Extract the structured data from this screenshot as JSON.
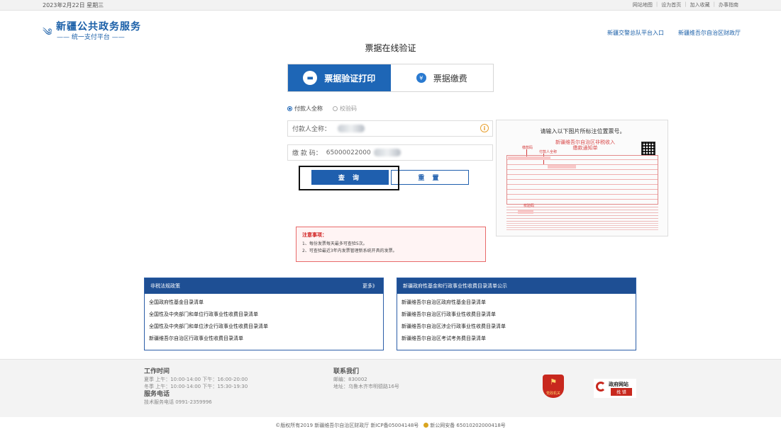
{
  "topbar": {
    "date": "2023年2月22日 星期三",
    "links": [
      "网站地图",
      "设为首页",
      "加入收藏",
      "办事指南"
    ]
  },
  "logo": {
    "name": "新疆公共政务服务",
    "sub": "—— 统一支付平台 ——"
  },
  "header": {
    "links": [
      "新疆交警总队平台入口",
      "新疆维吾尔自治区财政厅"
    ]
  },
  "page_title": "票据在线验证",
  "tabs": [
    {
      "label": "票据验证打印",
      "icon": "wallet-icon",
      "active": true
    },
    {
      "label": "票据缴费",
      "icon": "shield-icon",
      "active": false
    }
  ],
  "radios": [
    {
      "label": "付款人全称",
      "checked": true
    },
    {
      "label": "校验码",
      "checked": false
    }
  ],
  "form": {
    "payer_label": "付款人全称：",
    "payer_value": "",
    "code_label": "缴 款 码：",
    "code_value": "65000022000"
  },
  "buttons": {
    "query": "查 询",
    "reset": "重 置"
  },
  "sample": {
    "hint": "请输入以下图片所标注位置票号。",
    "invoice_title": "新疆维吾尔自治区非税收入",
    "invoice_subtitle": "缴款通知单",
    "pin1": "缴款码",
    "pin2": "付款人全称",
    "pin3": "校验码"
  },
  "notice": {
    "title": "注意事项：",
    "items": [
      "1、每份发票每天最多可查验5次。",
      "2、可查验最近3年内发票管理新系统开具的发票。"
    ]
  },
  "left_panel": {
    "title": "非税法规政策",
    "more": "更多》",
    "items": [
      "全国政府性基金目录清单",
      "全国性及中央部门和单位行政事业性收费目录清单",
      "全国性及中央部门和单位涉企行政事业性收费目录清单",
      "新疆维吾尔自治区行政事业性收费目录清单"
    ]
  },
  "right_panel": {
    "title": "新疆政府性基金和行政事业性收费目录清单公示",
    "items": [
      "新疆维吾尔自治区政府性基金目录清单",
      "新疆维吾尔自治区行政事业性收费目录清单",
      "新疆维吾尔自治区涉企行政事业性收费目录清单",
      "新疆维吾尔自治区考试考务费目录清单"
    ]
  },
  "footer": {
    "work_title": "工作时间",
    "summer": "夏季  上午：10:00-14:00  下午：16:00-20:00",
    "winter": "冬季  上午：10:00-14:00  下午：15:30-19:30",
    "service_title": "服务电话",
    "service_phone": "技术服务电话  0991-2359996",
    "contact_title": "联系我们",
    "postcode": "邮编：830002",
    "address": "地址：乌鲁木齐市明德路16号",
    "badge1": "党政机关",
    "badge2_title": "政府网站",
    "badge2_sub": "找 错"
  },
  "bottom": {
    "copyright": "©版权所有2019  新疆维吾尔自治区财政厅  新ICP备05004148号",
    "police": "新公网安备 65010202000418号"
  }
}
